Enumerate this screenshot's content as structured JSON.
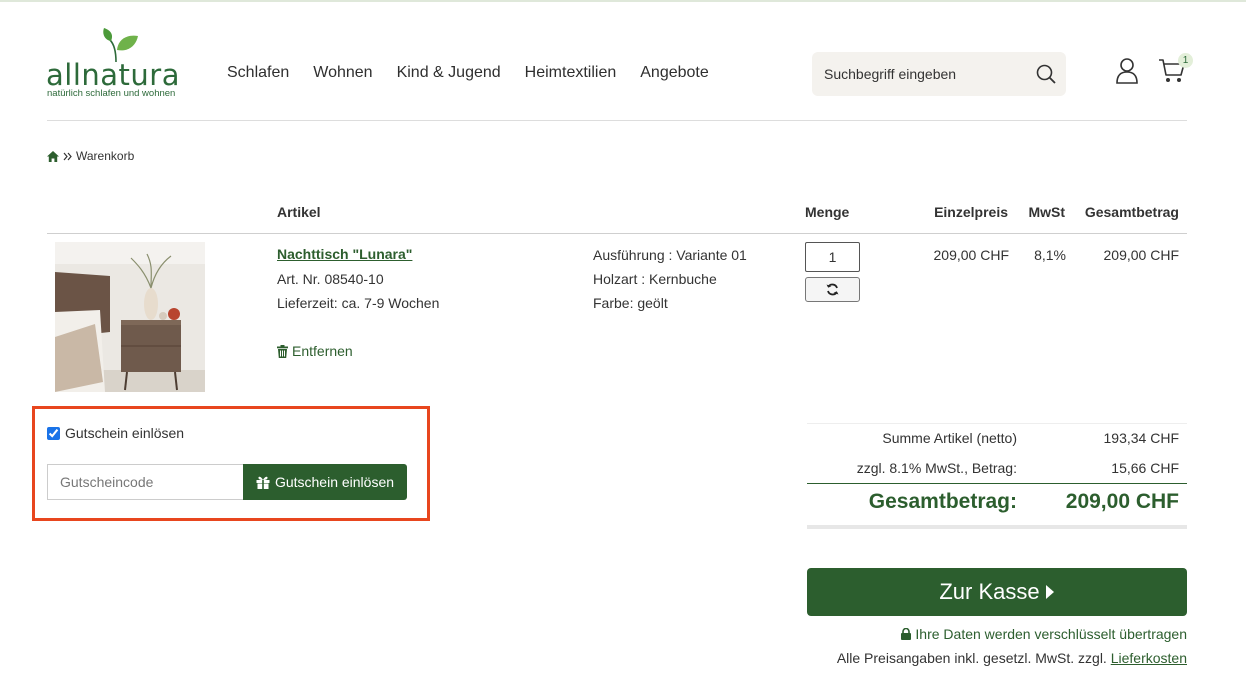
{
  "header": {
    "logo_text": "allnatura",
    "logo_tagline": "natürlich schlafen und wohnen",
    "nav": [
      "Schlafen",
      "Wohnen",
      "Kind & Jugend",
      "Heimtextilien",
      "Angebote"
    ],
    "search_placeholder": "Suchbegriff eingeben",
    "cart_count": "1"
  },
  "breadcrumb": {
    "current": "Warenkorb"
  },
  "cart_table": {
    "headers": {
      "article": "Artikel",
      "quantity": "Menge",
      "unit_price": "Einzelpreis",
      "vat": "MwSt",
      "total": "Gesamtbetrag"
    },
    "item": {
      "name": "Nachttisch \"Lunara\"",
      "article_number": "Art. Nr. 08540-10",
      "delivery": "Lieferzeit: ca. 7-9 Wochen",
      "variant": "Ausführung : Variante 01",
      "wood": "Holzart : Kernbuche",
      "color": "Farbe: geölt",
      "quantity": "1",
      "unit_price": "209,00 CHF",
      "vat": "8,1%",
      "total": "209,00 CHF",
      "remove_label": "Entfernen"
    }
  },
  "voucher": {
    "checkbox_label": "Gutschein einlösen",
    "checked": true,
    "input_placeholder": "Gutscheincode",
    "button_label": "Gutschein einlösen"
  },
  "summary": {
    "net_label": "Summe Artikel (netto)",
    "net_value": "193,34 CHF",
    "vat_label": "zzgl. 8.1% MwSt., Betrag:",
    "vat_value": "15,66 CHF",
    "total_label": "Gesamtbetrag:",
    "total_value": "209,00 CHF"
  },
  "checkout": {
    "button_label": "Zur Kasse",
    "secure_note": "Ihre Daten werden verschlüsselt übertragen",
    "price_note": "Alle Preisangaben inkl. gesetzl. MwSt. zzgl.",
    "shipping_link": "Lieferkosten"
  },
  "colors": {
    "brand_green": "#2c5e2e",
    "highlight": "#e8461e"
  }
}
